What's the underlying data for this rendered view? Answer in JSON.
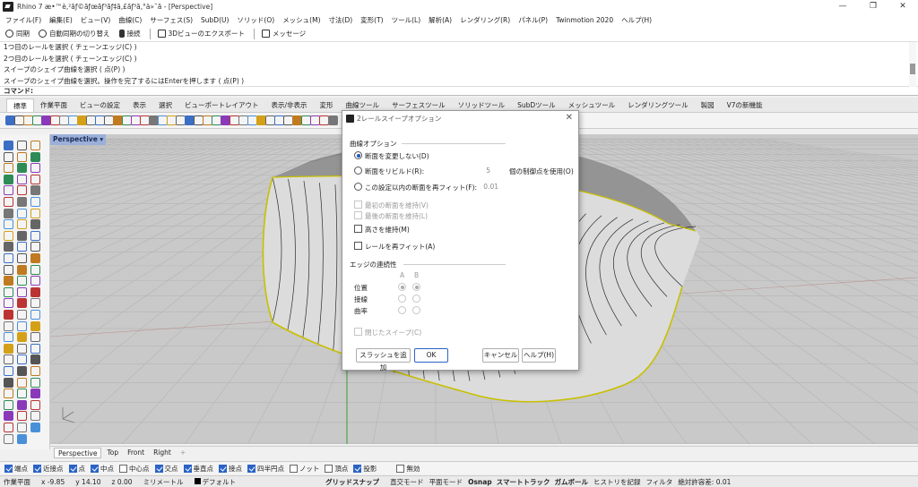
{
  "titlebar": {
    "title": "Rhino 7 æ•™è‚²ãƒ©ãƒœãƒ³ãƒ‡ã‚£ãƒ³ã‚°ä»˜ã - [Perspective]",
    "minimize": "—",
    "restore": "❐",
    "close": "✕"
  },
  "menu": [
    "ファイル(F)",
    "編集(E)",
    "ビュー(V)",
    "曲線(C)",
    "サーフェス(S)",
    "SubD(U)",
    "ソリッド(O)",
    "メッシュ(M)",
    "寸法(D)",
    "変形(T)",
    "ツール(L)",
    "解析(A)",
    "レンダリング(R)",
    "パネル(P)",
    "Twinmotion 2020",
    "ヘルプ(H)"
  ],
  "quickbar": {
    "sync": "同期",
    "auto_sync": "自動同期の切り替え",
    "connect": "接続",
    "export3d": "3Dビューのエクスポート",
    "message": "メッセージ"
  },
  "history": [
    "1つ目のレールを選択 ( チェーンエッジ(C) )",
    "2つ目のレールを選択 ( チェーンエッジ(C) )",
    "スイープのシェイプ曲線を選択 ( 点(P) )",
    "スイープのシェイプ曲線を選択。操作を完了するにはEnterを押します ( 点(P) )"
  ],
  "command_label": "コマンド:",
  "tabs": [
    "標準",
    "作業平面",
    "ビューの設定",
    "表示",
    "選択",
    "ビューポートレイアウト",
    "表示/非表示",
    "変形",
    "曲線ツール",
    "サーフェスツール",
    "ソリッドツール",
    "SubDツール",
    "メッシュツール",
    "レンダリングツール",
    "製図",
    "V7の新機能"
  ],
  "viewport": {
    "label": "Perspective",
    "tabs": [
      "Perspective",
      "Top",
      "Front",
      "Right"
    ],
    "add_tab": "+"
  },
  "dialog": {
    "title": "2レールスイープオプション",
    "close": "✕",
    "section_curve": "曲線オプション",
    "opt_no_change": "断面を変更しない(D)",
    "opt_rebuild": "断面をリビルド(R):",
    "rebuild_value": "5",
    "rebuild_suffix": "個の制御点を使用(O)",
    "opt_refit": "この設定以内の断面を再フィット(F):",
    "refit_value": "0.01",
    "keep_first": "最初の断面を維持(V)",
    "keep_last": "最後の断面を維持(L)",
    "keep_height": "高さを維持(M)",
    "refit_rail": "レールを再フィット(A)",
    "section_edge": "エッジの連続性",
    "col_a": "A",
    "col_b": "B",
    "row_position": "位置",
    "row_tangent": "接線",
    "row_curvature": "曲率",
    "closed_sweep": "閉じたスイープ(C)",
    "btn_add_slash": "スラッシュを追加",
    "btn_ok": "OK",
    "btn_cancel": "キャンセル",
    "btn_help": "ヘルプ(H)"
  },
  "osnap": [
    {
      "label": "端点",
      "on": true
    },
    {
      "label": "近接点",
      "on": true
    },
    {
      "label": "点",
      "on": true
    },
    {
      "label": "中点",
      "on": true
    },
    {
      "label": "中心点",
      "on": false
    },
    {
      "label": "交点",
      "on": true
    },
    {
      "label": "垂直点",
      "on": true
    },
    {
      "label": "接点",
      "on": true
    },
    {
      "label": "四半円点",
      "on": true
    },
    {
      "label": "ノット",
      "on": false
    },
    {
      "label": "頂点",
      "on": false
    },
    {
      "label": "投影",
      "on": true
    },
    {
      "label": "無効",
      "on": false
    }
  ],
  "status": {
    "cplane": "作業平面",
    "x": "x -9.85",
    "y": "y 14.10",
    "z": "z 0.00",
    "units": "ミリメートル",
    "layer": "デフォルト",
    "grid_snap": "グリッドスナップ",
    "ortho": "直交モード",
    "planar": "平面モード",
    "osnap": "Osnap",
    "smarttrack": "スマートトラック",
    "gumball": "ガムボール",
    "history": "ヒストリを記録",
    "filter": "フィルタ",
    "tolerance": "絶対許容差: 0.01"
  },
  "colors": {
    "viewport_bg": "#c9c9c9",
    "grid": "#b4b4b4",
    "surface_edge": "#c8c000",
    "accent": "#2b63c6"
  }
}
